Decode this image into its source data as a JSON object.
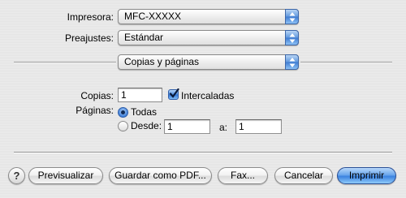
{
  "printer": {
    "label": "Impresora:",
    "value": "MFC-XXXXX"
  },
  "presets": {
    "label": "Preajustes:",
    "value": "Estándar"
  },
  "section": {
    "value": "Copias y páginas"
  },
  "copies": {
    "label": "Copias:",
    "value": "1",
    "collate_label": "Intercaladas",
    "collate_checked": true
  },
  "pages": {
    "label": "Páginas:",
    "all_label": "Todas",
    "from_label": "Desde:",
    "from_value": "1",
    "to_label": "a:",
    "to_value": "1",
    "selected": "all"
  },
  "buttons": {
    "help": "?",
    "preview": "Previsualizar",
    "save_pdf": "Guardar como PDF...",
    "fax": "Fax...",
    "cancel": "Cancelar",
    "print": "Imprimir"
  },
  "colors": {
    "accent": "#3b82e0"
  }
}
